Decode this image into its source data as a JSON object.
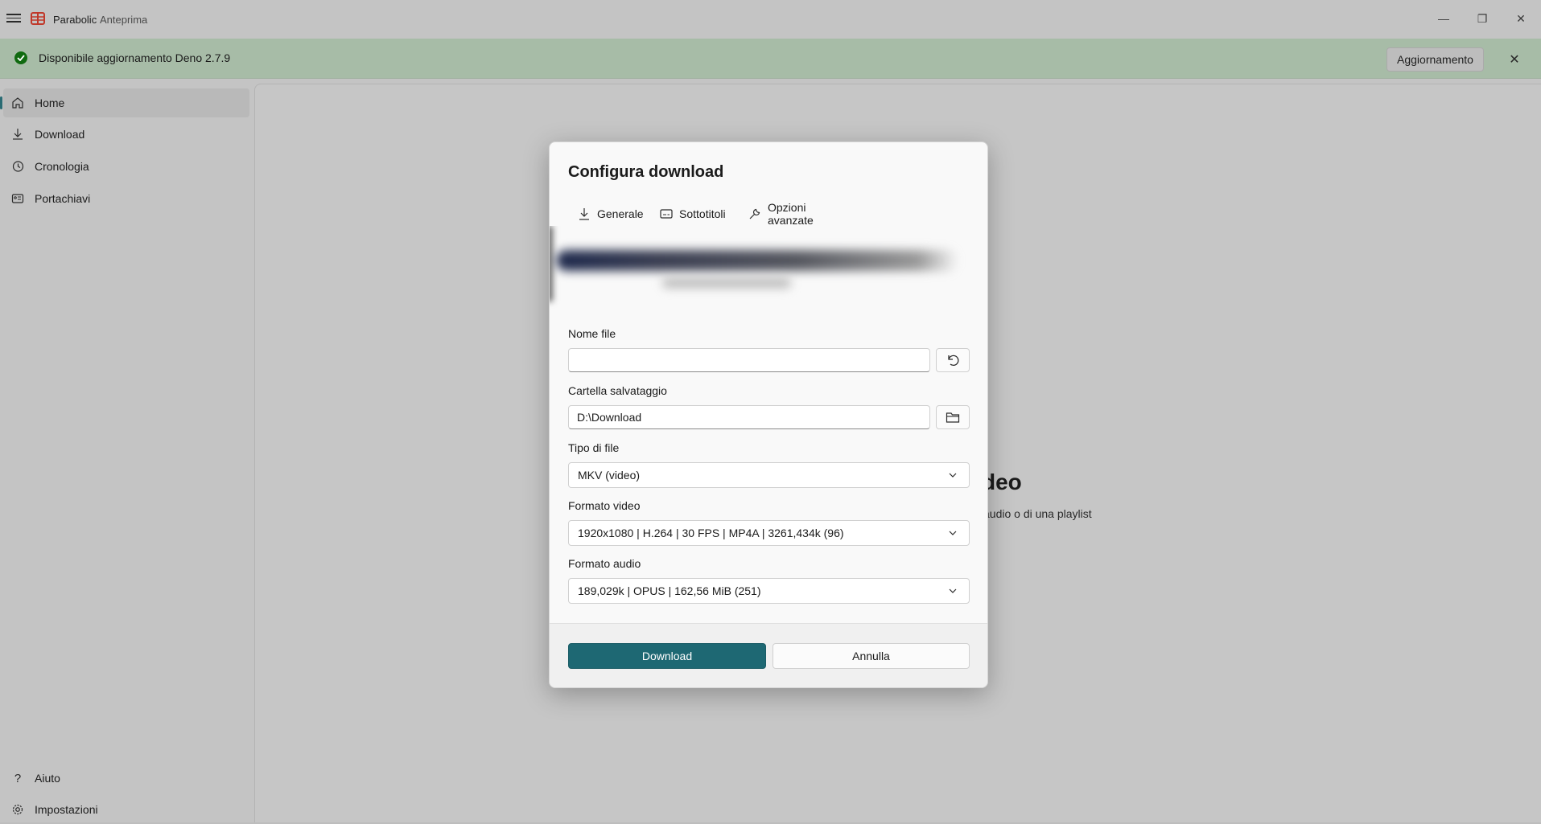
{
  "window": {
    "app_name": "Parabolic",
    "subtitle": "Anteprima",
    "minimize_glyph": "—",
    "maximize_glyph": "❐",
    "close_glyph": "✕"
  },
  "infobar": {
    "message": "Disponibile aggiornamento Deno 2.7.9",
    "action_label": "Aggiornamento",
    "close_glyph": "✕",
    "severity_color": "#106a10"
  },
  "sidebar": {
    "items": [
      {
        "label": "Home",
        "icon": "home-icon",
        "active": true
      },
      {
        "label": "Download",
        "icon": "download-icon"
      },
      {
        "label": "Cronologia",
        "icon": "history-icon"
      },
      {
        "label": "Portachiavi",
        "icon": "keyring-icon"
      }
    ],
    "footer_items": [
      {
        "label": "Aiuto",
        "icon": "help-icon"
      },
      {
        "label": "Impostazioni",
        "icon": "gear-icon"
      }
    ]
  },
  "background_page": {
    "title_fragment": "deo",
    "subtitle_fragment": "audio o di una playlist"
  },
  "dialog": {
    "title": "Configura download",
    "tabs": [
      {
        "label": "Generale",
        "icon": "download-icon"
      },
      {
        "label": "Sottotitoli",
        "icon": "subtitles-icon"
      },
      {
        "label": "Opzioni avanzate",
        "icon": "wrench-icon"
      }
    ],
    "filename": {
      "label": "Nome file",
      "value": ""
    },
    "save_folder": {
      "label": "Cartella salvataggio",
      "value": "D:\\Download"
    },
    "file_type": {
      "label": "Tipo di file",
      "value": "MKV (video)"
    },
    "video_format": {
      "label": "Formato video",
      "value": "1920x1080 | H.264 | 30 FPS | MP4A | 3261,434k (96)"
    },
    "audio_format": {
      "label": "Formato audio",
      "value": "189,029k | OPUS | 162,56 MiB (251)"
    },
    "primary_button": "Download",
    "secondary_button": "Annulla",
    "accent_color": "#1e6873"
  }
}
